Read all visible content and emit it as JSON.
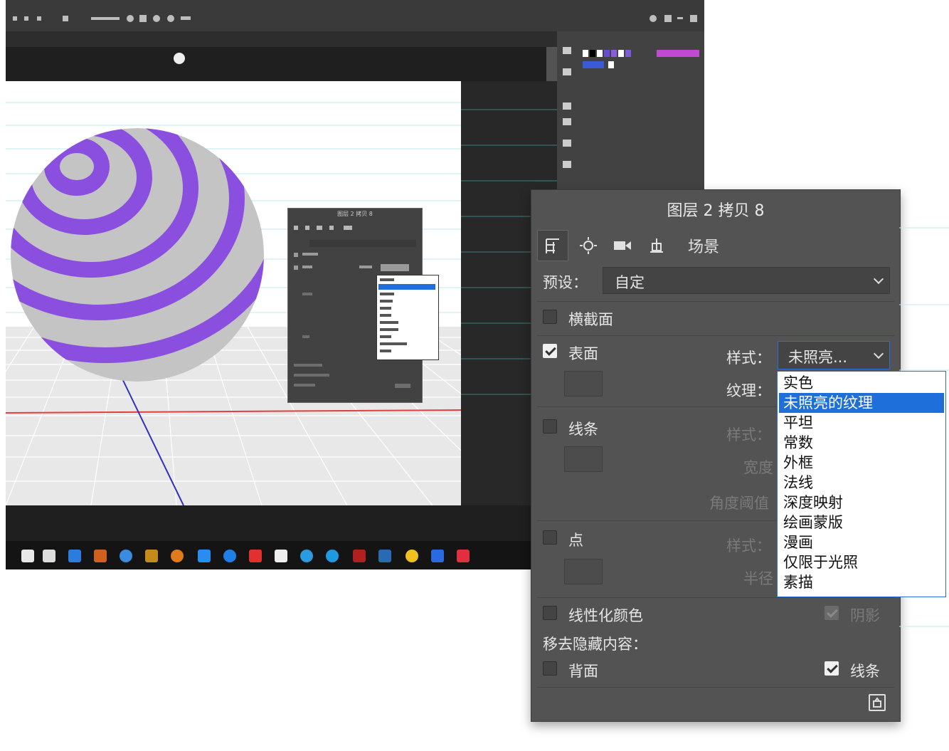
{
  "background_window": {
    "mini_panel_title": "图层 2 拷贝 8"
  },
  "panel": {
    "title": "图层 2 拷贝 8",
    "tabs": [
      {
        "icon": "mesh-icon"
      },
      {
        "icon": "light-icon"
      },
      {
        "icon": "camera-icon"
      },
      {
        "icon": "coordinates-icon"
      },
      {
        "label": "场景"
      }
    ],
    "preset_label": "预设：",
    "preset_value": "自定",
    "cross_section_label": "横截面",
    "surface_label": "表面",
    "surface_style_label": "样式：",
    "surface_style_value": "未照亮...",
    "surface_texture_label": "纹理：",
    "lines_label": "线条",
    "lines_style_label": "样式：",
    "lines_width_label": "宽度",
    "lines_angle_label": "角度阈值",
    "points_label": "点",
    "points_style_label": "样式：",
    "points_radius_label": "半径",
    "linearize_label": "线性化颜色",
    "shadow_label": "阴影",
    "remove_hidden_label": "移去隐藏内容：",
    "backface_label": "背面",
    "lines2_label": "线条",
    "style_options": [
      "实色",
      "未照亮的纹理",
      "平坦",
      "常数",
      "外框",
      "法线",
      "深度映射",
      "绘画蒙版",
      "漫画",
      "仅限于光照",
      "素描"
    ],
    "selected_option_index": 1
  },
  "colors": {
    "panel_bg": "#535353",
    "highlight": "#1e6fd9",
    "sphere_purple": "#8b4fe0",
    "sphere_grey": "#c4c4c4"
  }
}
